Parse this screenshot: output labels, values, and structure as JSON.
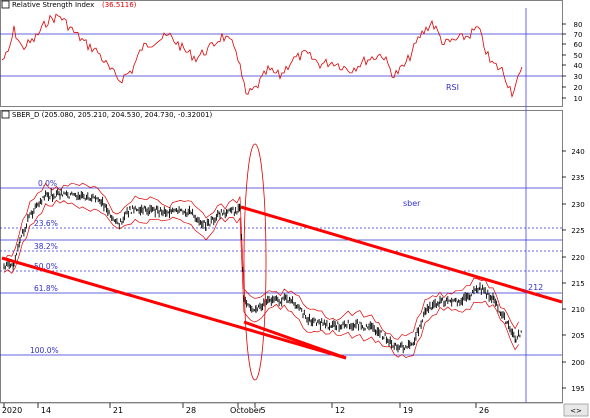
{
  "rsi_panel": {
    "title": "Relative Strength Index",
    "value": "(36.5116)",
    "label": "RSI",
    "y_ticks": [
      "80",
      "70",
      "60",
      "50",
      "40",
      "30",
      "20",
      "10"
    ]
  },
  "price_panel": {
    "header": "SBER_D (205.080, 205.210, 204.530, 204.730, -0.32001)",
    "symbol_label": "sber",
    "level_label": "212",
    "y_ticks": [
      "240",
      "235",
      "230",
      "225",
      "220",
      "215",
      "210",
      "205",
      "200",
      "195"
    ]
  },
  "fibonacci": {
    "levels": [
      "0.0%",
      "23.6%",
      "38.2%",
      "50.0%",
      "61.8%",
      "100.0%"
    ]
  },
  "x_axis": {
    "ticks": [
      "2020",
      "14",
      "21",
      "28",
      "October",
      "5",
      "12",
      "19",
      "26"
    ],
    "extra": "<>"
  },
  "colors": {
    "rsi_line": "#e00000",
    "price_bars": "#000000",
    "bollinger": "#e00000",
    "channel": "#e00000",
    "fib_lines": "#3030d0",
    "cursor": "#4040ff"
  }
}
